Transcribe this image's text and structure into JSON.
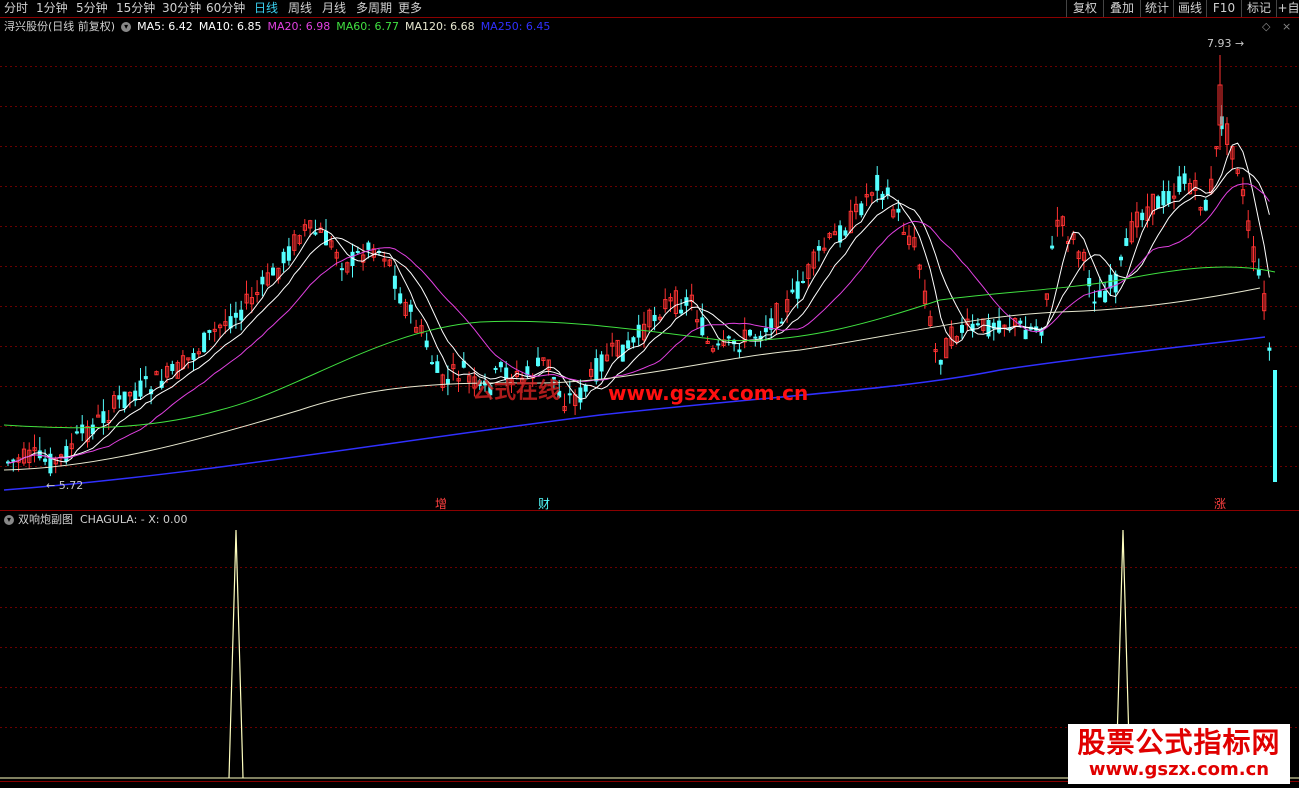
{
  "toolbar": {
    "tabs": [
      "分时",
      "1分钟",
      "5分钟",
      "15分钟",
      "30分钟",
      "60分钟",
      "日线",
      "周线",
      "月线",
      "多周期",
      "更多"
    ],
    "active_tab": "日线",
    "right_buttons": [
      "复权",
      "叠加",
      "统计",
      "画线",
      "F10",
      "标记",
      "+自"
    ]
  },
  "main_legend": {
    "title": "浔兴股份(日线 前复权)",
    "items": [
      {
        "label": "MA5: 6.42",
        "color": "#ffffff"
      },
      {
        "label": "MA10: 6.85",
        "color": "#ffffff"
      },
      {
        "label": "MA20: 6.98",
        "color": "#e040e0"
      },
      {
        "label": "MA60: 6.77",
        "color": "#40e040"
      },
      {
        "label": "MA120: 6.68",
        "color": "#e8e8d0"
      },
      {
        "label": "MA250: 6.45",
        "color": "#3030ff"
      }
    ]
  },
  "price_labels": {
    "high": "7.93",
    "low": "5.72"
  },
  "markers": [
    "增",
    "财",
    "涨"
  ],
  "sub_legend": {
    "title": "双响炮副图",
    "text": "CHAGULA: -  X: 0.00"
  },
  "watermark": {
    "center": "www.gszx.com.cn",
    "center_cn": "公式在线"
  },
  "logo": {
    "line1": "股票公式指标网",
    "line2": "www.gszx.com.cn"
  },
  "colors": {
    "up": "#ff3232",
    "down": "#54ffff",
    "ma5": "#ffffff",
    "ma10": "#ffffff",
    "ma20": "#e040e0",
    "ma60": "#40e040",
    "ma120": "#e8e8d0",
    "ma250": "#3030ff",
    "grid": "#6a0000",
    "spike": "#ffffc0"
  }
}
